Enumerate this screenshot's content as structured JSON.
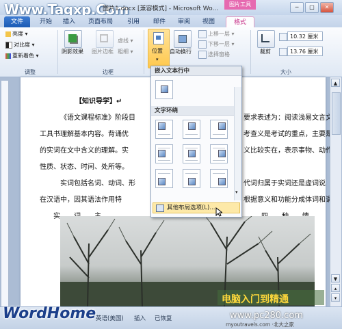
{
  "window": {
    "title": "图片1.docx [兼容模式] - Microsoft Wo...",
    "context_tab": "图片工具",
    "controls": [
      "─",
      "□",
      "✕"
    ]
  },
  "watermarks": {
    "top": "Www.Tagxp.Com",
    "bottom": "WordHome",
    "badge": "电脑入门到精通",
    "url": "www.pc280.com",
    "small": "myoutravels.com ·北大之家"
  },
  "tabs": [
    "文件",
    "开始",
    "插入",
    "页面布局",
    "引用",
    "邮件",
    "审阅",
    "视图",
    "格式"
  ],
  "ribbon": {
    "adjust": {
      "label": "调整",
      "items": [
        "亮度 ▾",
        "对比度 ▾",
        "重新着色 ▾"
      ]
    },
    "border": {
      "label": "边框",
      "shadow": "阴影效果",
      "pic_border": "图片边框",
      "dashes": "虚线 ▾",
      "thickness": "粗细 ▾"
    },
    "arrange": {
      "position": "位置",
      "wrap": "自动换行",
      "bring_forward": "上移一层 ▾",
      "send_backward": "下移一层 ▾",
      "selection_pane": "选择窗格"
    },
    "size": {
      "label": "大小",
      "crop": "裁剪",
      "height": "10.32 厘米",
      "width": "13.76 厘米"
    }
  },
  "dropdown": {
    "inline_header": "嵌入文本行中",
    "wrap_header": "文字环绕",
    "more_options": "其他布局选项(L)..."
  },
  "document": {
    "lines": [
      "【知识导学】↵",
      "《语文课程标准》阶段目",
      "工具书理解基本内容。背诵优",
      "的实词在文中含义的理解。实",
      "性质、状态、时间、处所等。",
      "实词包括名词、动词、形",
      "在汉语中，因其语法作用特",
      "实　　词　　主"
    ],
    "right_fragments": [
      "要求表述为：阅读浅易文言文",
      "考查义是考试的重点，主要是",
      "义比较实在，表示事物、动作",
      "代词归属于实词还是虚词说",
      "根据意义和功能分成体词和谓",
      "四　　种　　情"
    ]
  },
  "status_bar": {
    "language": "中文(中国)",
    "lang2": "英语(美国)",
    "insert": "插入",
    "recover": "已恢复"
  }
}
